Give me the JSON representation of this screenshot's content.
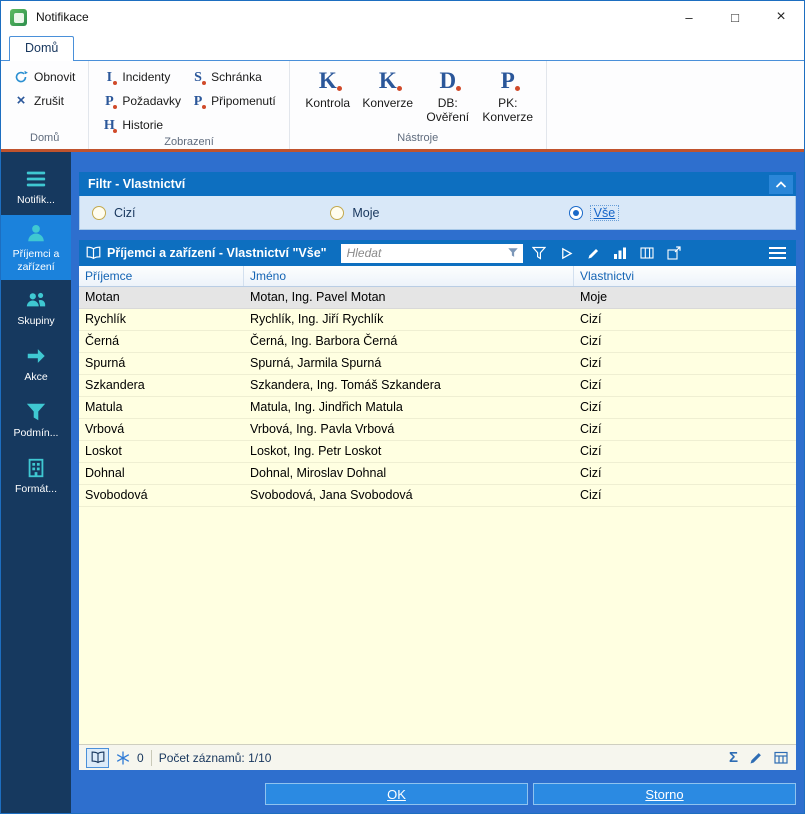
{
  "window": {
    "title": "Notifikace",
    "minimize_glyph": "–",
    "maximize_glyph": "□",
    "close_glyph": "×"
  },
  "ribbon": {
    "tab": "Domů",
    "groups": [
      {
        "label": "Domů",
        "buttons": [
          {
            "label": "Obnovit"
          },
          {
            "label": "Zrušit"
          }
        ]
      },
      {
        "label": "Zobrazení",
        "buttons": [
          {
            "label": "Incidenty",
            "letter": "I"
          },
          {
            "label": "Požadavky",
            "letter": "P"
          },
          {
            "label": "Historie",
            "letter": "H"
          },
          {
            "label": "Schránka",
            "letter": "S"
          },
          {
            "label": "Připomenutí",
            "letter": "P"
          }
        ]
      },
      {
        "label": "Nástroje",
        "buttons": [
          {
            "label": "Kontrola",
            "letter": "K"
          },
          {
            "label": "Konverze",
            "letter": "K"
          },
          {
            "label": "DB:\nOvěření",
            "letter": "D"
          },
          {
            "label": "PK:\nKonverze",
            "letter": "P"
          }
        ]
      }
    ]
  },
  "sidebar": {
    "items": [
      {
        "label": "Notifik..."
      },
      {
        "label": "Příjemci a zařízení",
        "selected": true
      },
      {
        "label": "Skupiny"
      },
      {
        "label": "Akce"
      },
      {
        "label": "Podmín..."
      },
      {
        "label": "Formát..."
      }
    ]
  },
  "filter": {
    "title": "Filtr - Vlastnictví",
    "options": [
      {
        "label": "Cizí",
        "selected": false
      },
      {
        "label": "Moje",
        "selected": false
      },
      {
        "label": "Vše",
        "selected": true
      }
    ]
  },
  "table": {
    "title": "Příjemci a zařízení - Vlastnictví \"Vše\"",
    "search_placeholder": "Hledat",
    "columns": [
      "Příjemce",
      "Jméno",
      "Vlastnictvi"
    ],
    "rows": [
      [
        "Motan",
        "Motan, Ing. Pavel Motan",
        "Moje"
      ],
      [
        "Rychlík",
        "Rychlík, Ing. Jiří Rychlík",
        "Cizí"
      ],
      [
        "Černá",
        "Černá, Ing. Barbora Černá",
        "Cizí"
      ],
      [
        "Spurná",
        "Spurná, Jarmila Spurná",
        "Cizí"
      ],
      [
        "Szkandera",
        "Szkandera, Ing. Tomáš Szkandera",
        "Cizí"
      ],
      [
        "Matula",
        "Matula, Ing. Jindřich Matula",
        "Cizí"
      ],
      [
        "Vrbová",
        "Vrbová, Ing. Pavla Vrbová",
        "Cizí"
      ],
      [
        "Loskot",
        "Loskot, Ing. Petr Loskot",
        "Cizí"
      ],
      [
        "Dohnal",
        "Dohnal, Miroslav Dohnal",
        "Cizí"
      ],
      [
        "Svobodová",
        "Svobodová, Jana Svobodová",
        "Cizí"
      ]
    ],
    "status": {
      "frozen_count": "0",
      "count_label": "Počet záznamů: 1/10"
    }
  },
  "footer": {
    "ok": "OK",
    "storno": "Storno"
  },
  "colors": {
    "panel_header_blue": "#0d6fc0",
    "main_background_blue": "#2e6fce",
    "sidebar_blue": "#16395f",
    "sidebar_selected_blue": "#1b82dc",
    "grid_yellow": "#ffffe1",
    "selected_row_gray": "#e5e5e5",
    "sidebar_icon_teal": "#3fc8d2",
    "accent_line_orange": "#c0532d"
  }
}
